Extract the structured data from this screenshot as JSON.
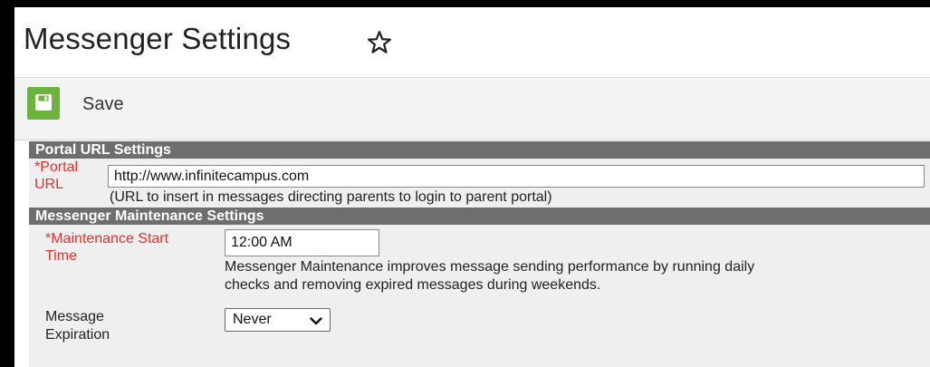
{
  "page": {
    "title": "Messenger Settings",
    "star_icon": "star-outline-icon"
  },
  "toolbar": {
    "save_label": "Save",
    "save_icon": "floppy-disk-icon",
    "save_icon_color": "#6cb33f"
  },
  "portal_section": {
    "header": "Portal URL Settings",
    "portal_url_label_line1": "*Portal",
    "portal_url_label_line2": "URL",
    "portal_url_value": "http://www.infinitecampus.com",
    "portal_url_help": "(URL to insert in messages directing parents to login to parent portal)"
  },
  "maintenance_section": {
    "header": "Messenger Maintenance Settings",
    "start_time_label_line1": "*Maintenance Start",
    "start_time_label_line2": "Time",
    "start_time_value": "12:00 AM",
    "help_line1": "Messenger Maintenance improves message sending performance by running daily",
    "help_line2": "checks and removing expired messages during weekends.",
    "expiration_label_line1": "Message",
    "expiration_label_line2": "Expiration",
    "expiration_selected": "Never"
  },
  "colors": {
    "section_header_bg": "#6e6e6e",
    "required_label": "#e0332b",
    "content_bg": "#efefef"
  }
}
